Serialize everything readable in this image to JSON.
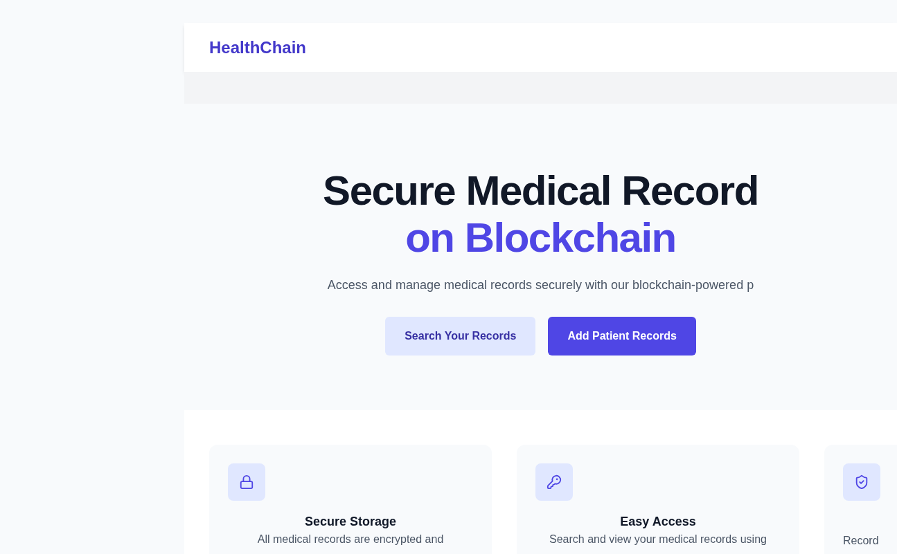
{
  "brand": "HealthChain",
  "hero": {
    "title": "Secure Medical Record",
    "title_accent": "on Blockchain",
    "subtitle": "Access and manage medical records securely with our blockchain-powered p",
    "buttons": [
      {
        "label": "Search Your Records",
        "kind": "secondary"
      },
      {
        "label": "Add Patient Records",
        "kind": "primary"
      }
    ]
  },
  "features": [
    {
      "kind": "lock",
      "title": "Secure Storage",
      "description": "All medical records are encrypted and"
    },
    {
      "kind": "key",
      "title": "Easy Access",
      "description": "Search and view your medical records using"
    },
    {
      "kind": "shield",
      "description": "Record"
    }
  ]
}
